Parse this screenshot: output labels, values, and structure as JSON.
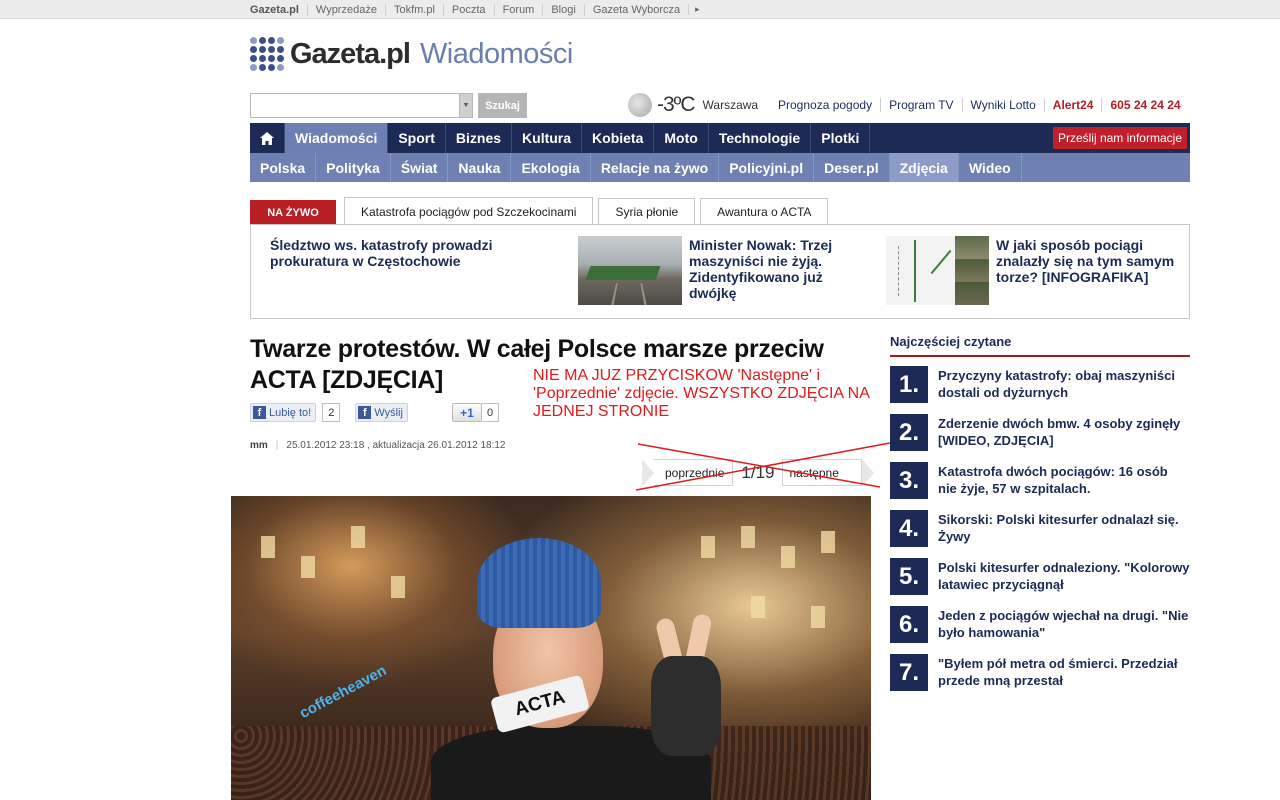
{
  "topbar": {
    "links": [
      "Gazeta.pl",
      "Wyprzedaże",
      "Tokfm.pl",
      "Poczta",
      "Forum",
      "Blogi",
      "Gazeta Wyborcza"
    ],
    "more_icon": "▸"
  },
  "logo": {
    "brand": "Gazeta.pl",
    "section": "Wiadomości"
  },
  "search": {
    "value": "",
    "button": "Szukaj"
  },
  "weather": {
    "temp": "-3ºC",
    "city": "Warszawa"
  },
  "toplinks": [
    "Prognoza pogody",
    "Program TV",
    "Wyniki Lotto",
    "Alert24",
    "605 24 24 24"
  ],
  "nav": {
    "main": [
      "Wiadomości",
      "Sport",
      "Biznes",
      "Kultura",
      "Kobieta",
      "Moto",
      "Technologie",
      "Plotki"
    ],
    "active_main": "Wiadomości",
    "send": "Prześlij nam informacje",
    "sub": [
      "Polska",
      "Polityka",
      "Świat",
      "Nauka",
      "Ekologia",
      "Relacje na żywo",
      "Policyjni.pl",
      "Deser.pl",
      "Zdjęcia",
      "Wideo"
    ],
    "active_sub": "Zdjęcia"
  },
  "live": {
    "label": "NA ŻYWO",
    "tabs": [
      "Katastrofa pociągów pod Szczekocinami",
      "Syria płonie",
      "Awantura o ACTA"
    ],
    "items": [
      "Śledztwo ws. katastrofy prowadzi prokuratura w Częstochowie",
      "Minister Nowak: Trzej maszyniści nie żyją. Zidentyfikowano już dwójkę",
      "W jaki sposób pociągi znalazły się na tym samym torze? [INFOGRAFIKA]"
    ]
  },
  "article": {
    "headline": "Twarze protestów. W całej Polsce marsze przeciw ACTA [ZDJĘCIA]",
    "like_label": "Lubię to!",
    "like_count": "2",
    "share_label": "Wyślij",
    "gplus_label": "+1",
    "gplus_count": "0",
    "author": "mm",
    "date": "25.01.2012 23:18 , aktualizacja 26.01.2012 18:12",
    "pager": {
      "prev": "poprzednie",
      "position": "1/19",
      "next": "następne"
    },
    "annotation": "NIE MA JUZ PRZYCISKOW 'Następne' i 'Poprzednie' zdjęcie. WSZYSTKO ZDJĘCIA NA JEDNEJ STRONIE",
    "photo_sign": "coffeeheaven",
    "photo_tape": "ACTA"
  },
  "sidebar": {
    "title": "Najczęściej czytane",
    "items": [
      {
        "n": "1.",
        "text": "Przyczyny katastrofy: obaj maszyniści dostali od dyżurnych"
      },
      {
        "n": "2.",
        "text": "Zderzenie dwóch bmw. 4 osoby zginęły [WIDEO, ZDJĘCIA]"
      },
      {
        "n": "3.",
        "text": "Katastrofa dwóch pociągów: 16 osób nie żyje, 57 w szpitalach."
      },
      {
        "n": "4.",
        "text": "Sikorski: Polski kitesurfer odnalazł się. Żywy"
      },
      {
        "n": "5.",
        "text": "Polski kitesurfer odnaleziony. \"Kolorowy latawiec przyciągnął"
      },
      {
        "n": "6.",
        "text": "Jeden z pociągów wjechał na drugi. \"Nie było hamowania\""
      },
      {
        "n": "7.",
        "text": "\"Byłem pół metra od śmierci. Przedział przede mną przestał"
      }
    ]
  },
  "colors": {
    "nav_dark": "#1d2a55",
    "nav_light": "#6e81b2",
    "accent_red": "#b91d26",
    "annotation_red": "#e01b1b"
  }
}
